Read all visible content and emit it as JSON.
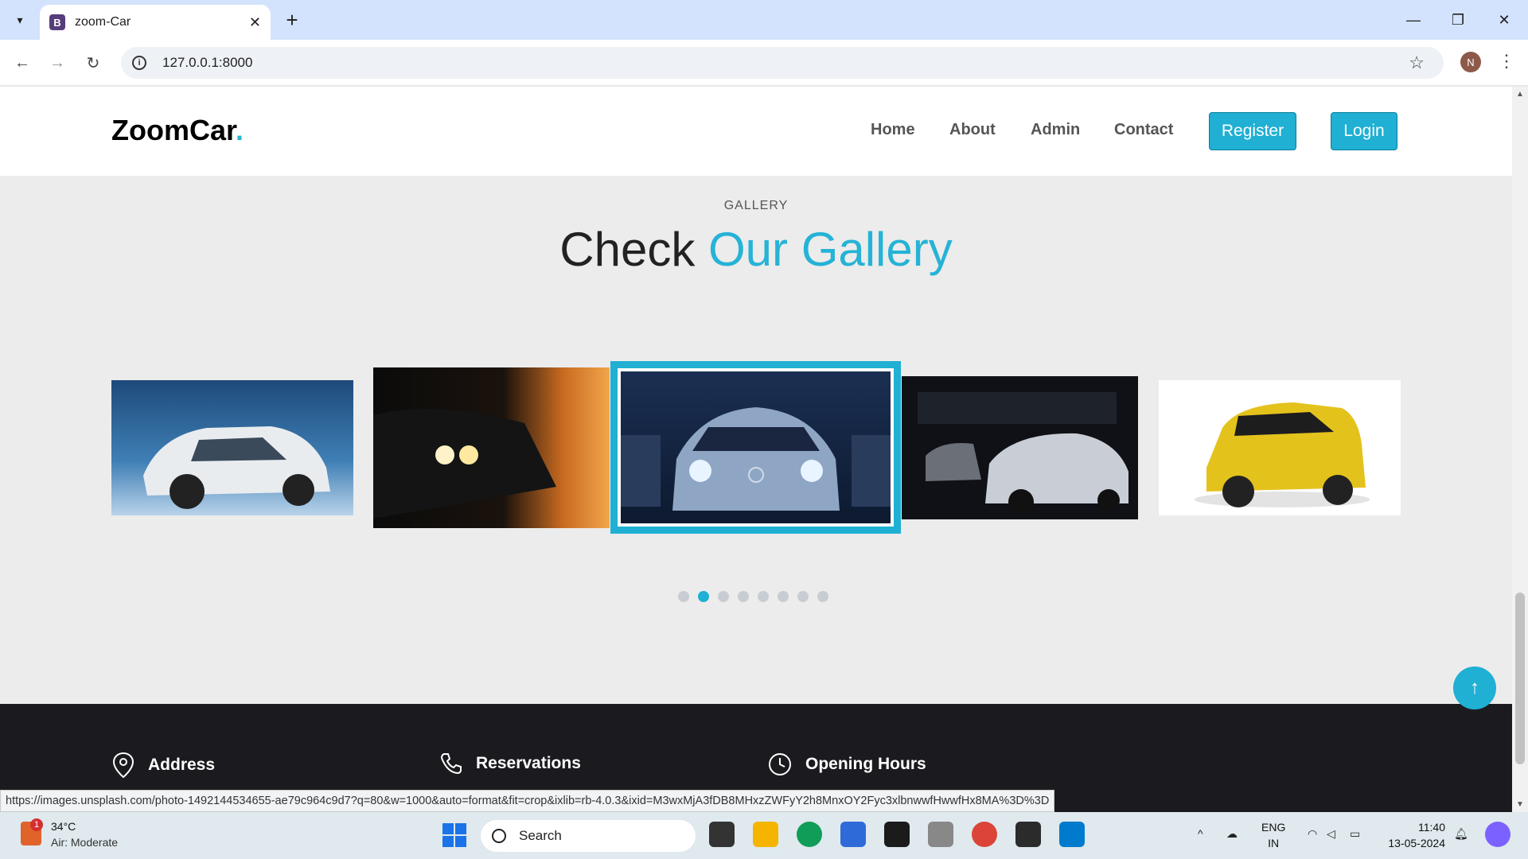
{
  "browser": {
    "tab_title": "zoom-Car",
    "favicon_letter": "B",
    "url": "127.0.0.1:8000",
    "profile_initial": "N",
    "status_url": "https://images.unsplash.com/photo-1492144534655-ae79c964c9d7?q=80&w=1000&auto=format&fit=crop&ixlib=rb-4.0.3&ixid=M3wxMjA3fDB8MHxzZWFyY2h8MnxOY2Fyc3xlbnwwfHwwfHx8MA%3D%3D"
  },
  "site": {
    "logo_text": "ZoomCar",
    "logo_dot": ".",
    "nav": [
      "Home",
      "About",
      "Admin",
      "Contact"
    ],
    "register_label": "Register",
    "login_label": "Login"
  },
  "gallery": {
    "label": "GALLERY",
    "title_plain": "Check ",
    "title_accent": "Our Gallery",
    "dots_count": 8,
    "active_dot": 2,
    "photos": [
      "white-suzuki-baleno",
      "dark-car-headlights-sunset",
      "mercedes-headlights",
      "white-camaro-garage",
      "yellow-suv"
    ]
  },
  "footer": {
    "address_label": "Address",
    "reservations_label": "Reservations",
    "hours_label": "Opening Hours"
  },
  "taskbar": {
    "temp": "34°C",
    "air": "Air: Moderate",
    "weather_badge": "1",
    "search_placeholder": "Search",
    "lang_top": "ENG",
    "lang_bottom": "IN",
    "time": "11:40",
    "date": "13-05-2024"
  },
  "colors": {
    "accent": "#1fb0d3",
    "footer_bg": "#1b1b1f",
    "tabbar_bg": "#d3e3fd"
  }
}
